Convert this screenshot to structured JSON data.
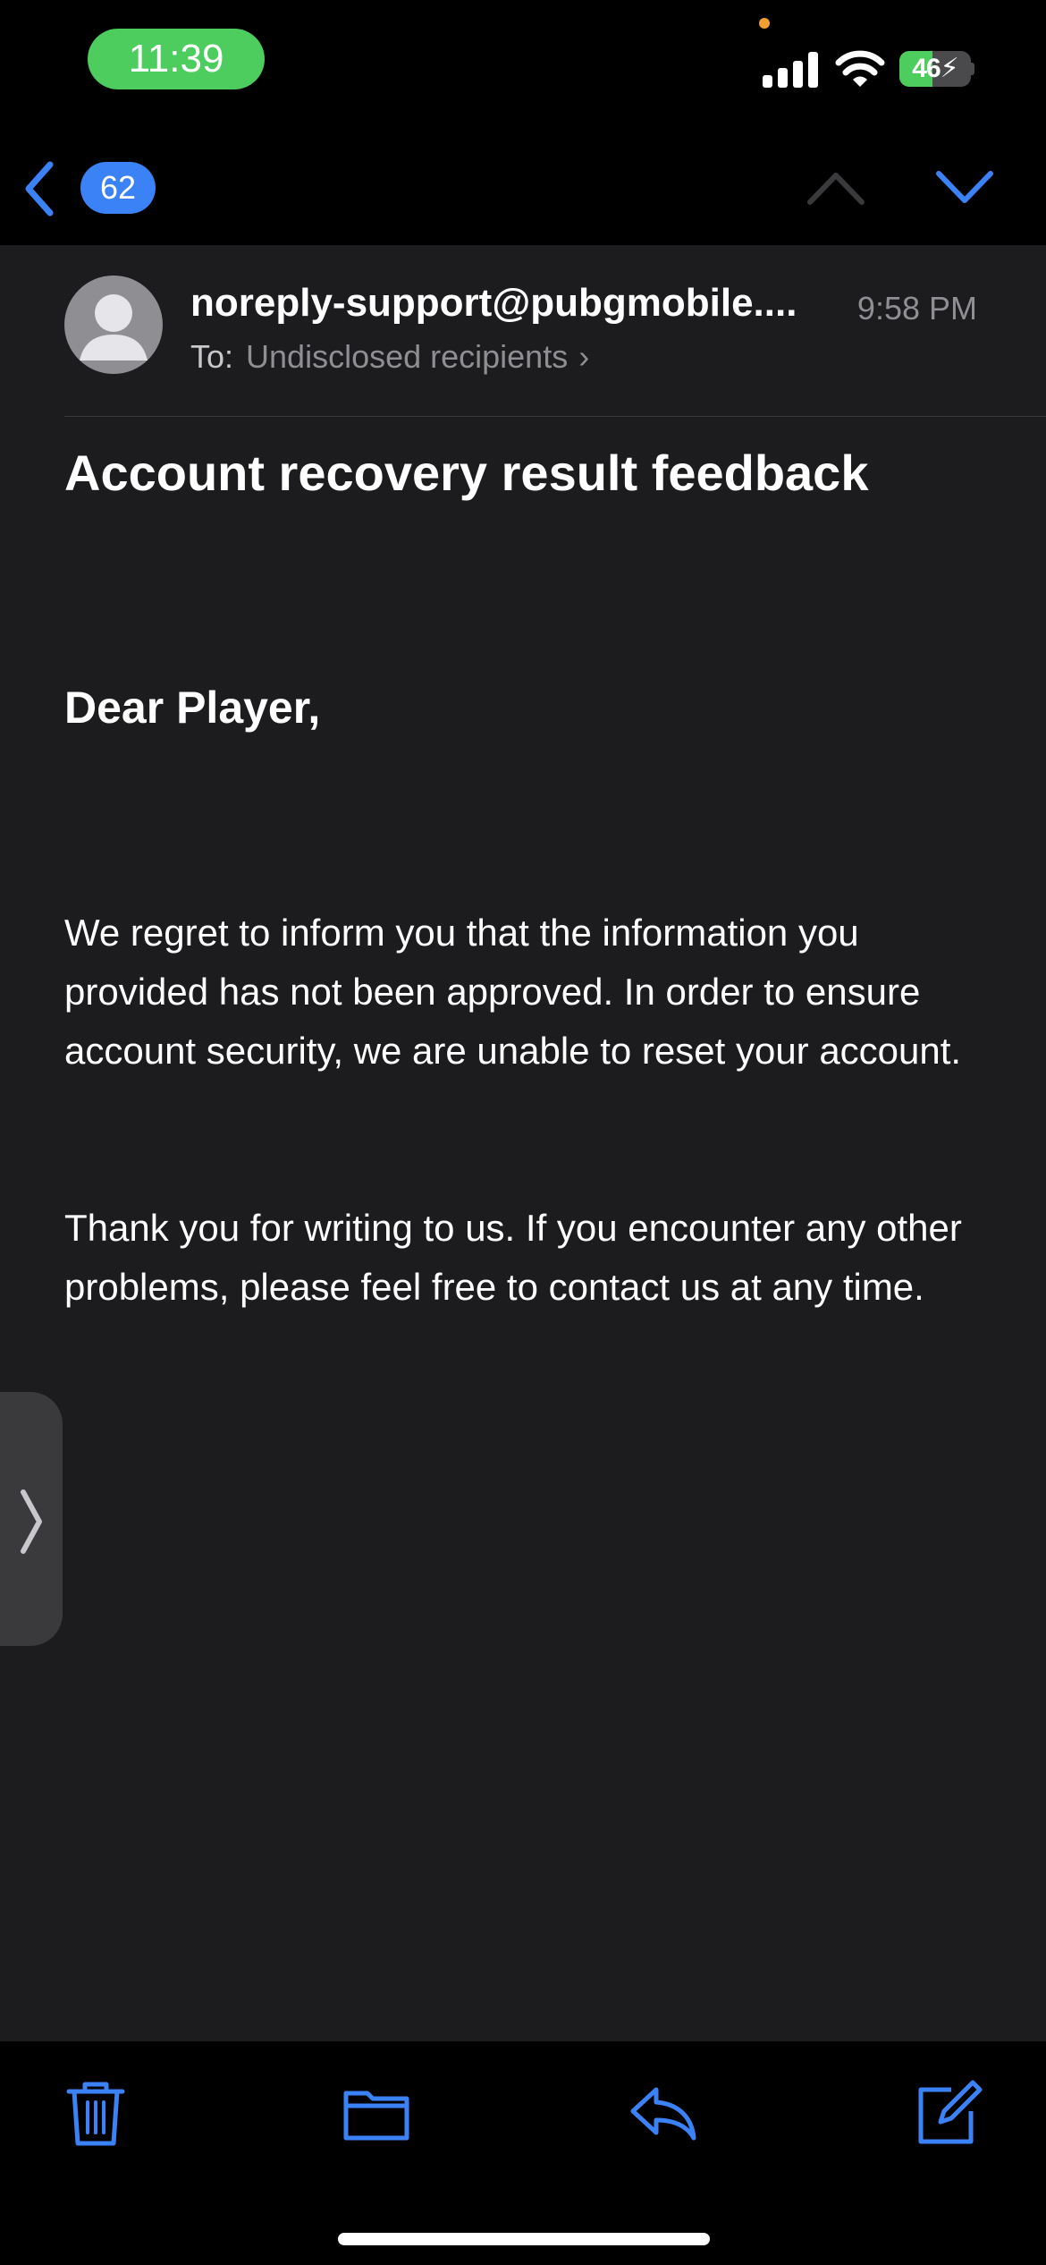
{
  "status_bar": {
    "time": "11:39",
    "battery_level": "46",
    "battery_fraction": 0.46,
    "icons": [
      "signal-icon",
      "wifi-icon",
      "battery-charging-icon"
    ]
  },
  "nav": {
    "unread_count": "62",
    "icons": [
      "back-chevron-icon",
      "previous-message-icon",
      "next-message-icon"
    ]
  },
  "email": {
    "sender": "noreply-support@pubgmobile....",
    "time": "9:58 PM",
    "to_label": "To:",
    "to_value": "Undisclosed recipients",
    "subject": "Account recovery result feedback",
    "greeting": "Dear Player,",
    "paragraphs": [
      "We regret to inform you that the information you provided has not been approved. In order to ensure account security, we are unable to reset your account.",
      "Thank you for writing to us. If you encounter any other problems, please feel free to contact us at any time."
    ]
  },
  "toolbar": {
    "icons": [
      "trash-icon",
      "folder-icon",
      "reply-icon",
      "compose-icon"
    ]
  },
  "colors": {
    "accent": "#3b82f6",
    "background": "#1c1c1e",
    "bars": "#000000",
    "time_pill": "#4ccd5d",
    "secondary_text": "#8e8e93"
  }
}
